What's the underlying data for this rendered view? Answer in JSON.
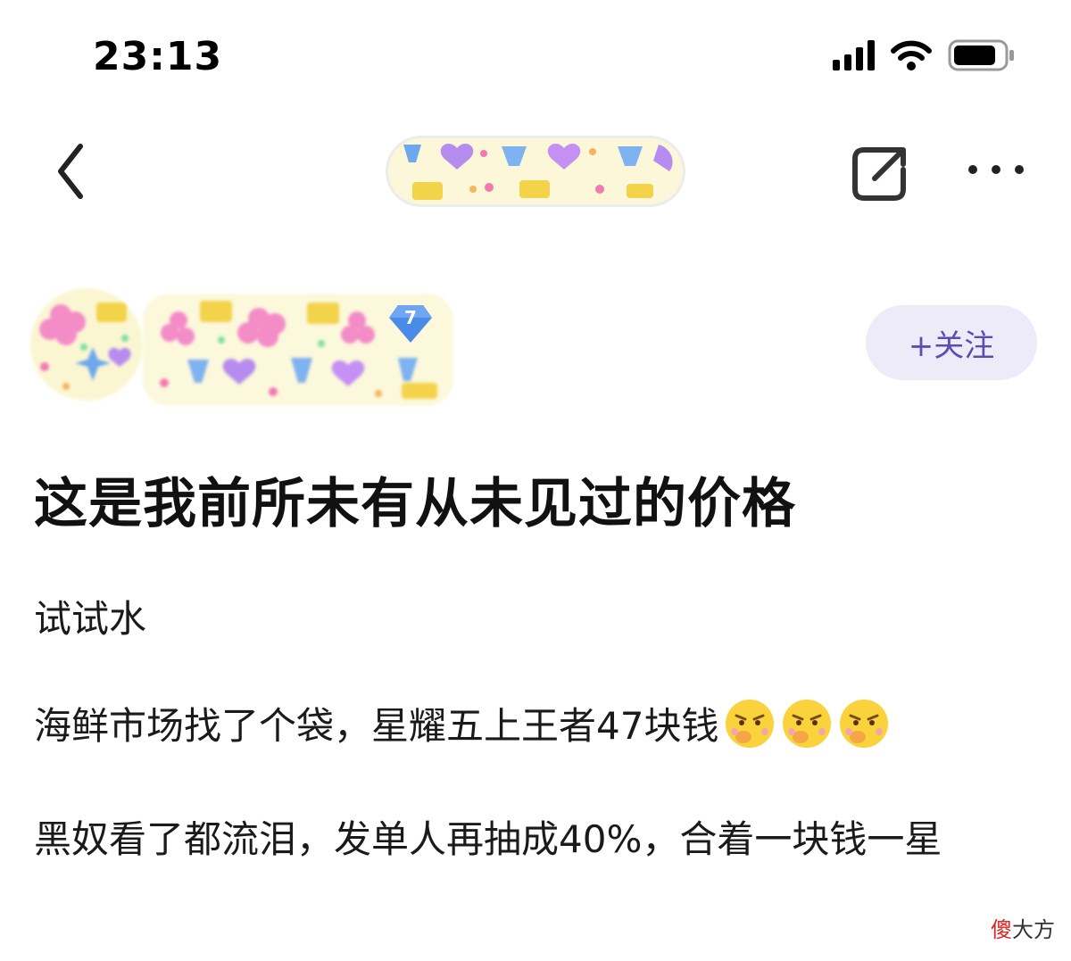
{
  "status_bar": {
    "time": "23:13",
    "icons": [
      "signal-icon",
      "wifi-icon",
      "battery-icon"
    ]
  },
  "nav": {
    "icons": [
      "back-chevron-icon",
      "share-icon",
      "more-dots-icon"
    ]
  },
  "author": {
    "level": "7",
    "follow_label": "+关注"
  },
  "post": {
    "title": "这是我前所未有从未见过的价格",
    "paragraphs": [
      "试试水",
      "海鲜市场找了个袋，星耀五上王者47块钱",
      "黑奴看了都流泪，发单人再抽成40%，合着一块钱一星"
    ],
    "emoji_name": "angry-face-icon"
  },
  "watermark": {
    "part1": "傻",
    "part2": "大方"
  },
  "colors": {
    "follow_bg": "#eeebf8",
    "follow_text": "#5a4fb0",
    "badge_blue": "#4a8be8"
  }
}
